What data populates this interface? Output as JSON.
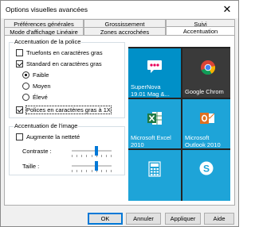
{
  "window": {
    "title": "Options visuelles avancées",
    "close_glyph": "✕"
  },
  "tabs": {
    "row1": [
      "Préférences générales",
      "Grossissement",
      "Suivi"
    ],
    "row2": [
      "Mode d'affichage Linéaire",
      "Zones accrochées",
      "Accentuation"
    ],
    "active": "Accentuation"
  },
  "font_group": {
    "title": "Accentuation de la police",
    "truefonts": {
      "label": "Truefonts en caractères gras",
      "checked": false
    },
    "standard": {
      "label": "Standard en caractères gras",
      "checked": true
    },
    "weights": [
      {
        "label": "Faible",
        "checked": true
      },
      {
        "label": "Moyen",
        "checked": false
      },
      {
        "label": "Élevé",
        "checked": false
      }
    ],
    "policies": {
      "label": "Polices en caractères gras à 1X",
      "checked": true
    }
  },
  "image_group": {
    "title": "Accentuation de l'image",
    "sharpness": {
      "label": "Augmente la netteté",
      "checked": false
    },
    "contrast_label": "Contraste :",
    "contrast_value": 0.63,
    "size_label": "Taille :",
    "size_value": 0.63
  },
  "preview": {
    "tiles": [
      {
        "label1": "SuperNova",
        "label2": "19.01 Mag &...",
        "icon": "supernova-icon",
        "color": "#0090c8"
      },
      {
        "label1": "Google Chrom",
        "label2": "",
        "icon": "chrome-icon",
        "color": "#3a3a3a"
      },
      {
        "label1": "Microsoft Excel",
        "label2": "2010",
        "icon": "excel-icon",
        "color": "#1ea4d8"
      },
      {
        "label1": "Microsoft",
        "label2": "Outlook 2010",
        "icon": "outlook-icon",
        "color": "#1ea4d8"
      },
      {
        "label1": "",
        "label2": "",
        "icon": "calculator-icon",
        "color": "#1ea4d8"
      },
      {
        "label1": "",
        "label2": "",
        "icon": "skype-icon",
        "color": "#1ea4d8"
      }
    ]
  },
  "buttons": {
    "ok": "OK",
    "cancel": "Annuler",
    "apply": "Appliquer",
    "help": "Aide"
  }
}
